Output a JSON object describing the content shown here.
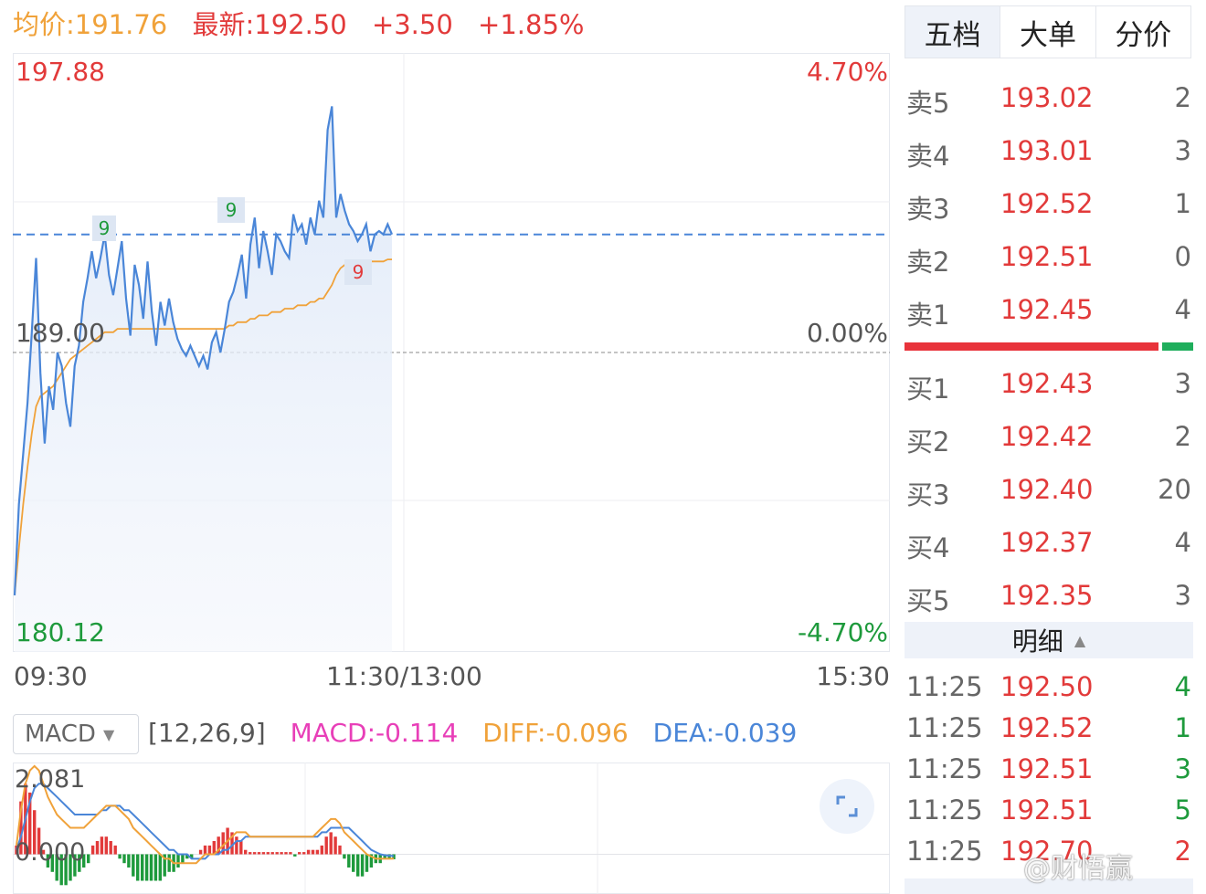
{
  "header": {
    "avg_label": "均价:191.76",
    "latest_label": "最新:192.50",
    "change": "+3.50",
    "change_pct": "+1.85%"
  },
  "axis": {
    "price_high": "197.88",
    "price_mid": "189.00",
    "price_low": "180.12",
    "pct_high": "4.70%",
    "pct_mid": "0.00%",
    "pct_low": "-4.70%",
    "time_start": "09:30",
    "time_mid": "11:30/13:00",
    "time_end": "15:30",
    "badges": [
      "9",
      "9",
      "9"
    ]
  },
  "macd": {
    "dropdown": "MACD",
    "params": "[12,26,9]",
    "macd": "MACD:-0.114",
    "diff": "DIFF:-0.096",
    "dea": "DEA:-0.039",
    "y_top": "2.081",
    "y_zero": "0.000"
  },
  "tabs": [
    "五档",
    "大单",
    "分价"
  ],
  "orderbook": {
    "asks": [
      {
        "name": "卖5",
        "price": "193.02",
        "vol": "2"
      },
      {
        "name": "卖4",
        "price": "193.01",
        "vol": "3"
      },
      {
        "name": "卖3",
        "price": "192.52",
        "vol": "1"
      },
      {
        "name": "卖2",
        "price": "192.51",
        "vol": "0"
      },
      {
        "name": "卖1",
        "price": "192.45",
        "vol": "4"
      }
    ],
    "bids": [
      {
        "name": "买1",
        "price": "192.43",
        "vol": "3"
      },
      {
        "name": "买2",
        "price": "192.42",
        "vol": "2"
      },
      {
        "name": "买3",
        "price": "192.40",
        "vol": "20"
      },
      {
        "name": "买4",
        "price": "192.37",
        "vol": "4"
      },
      {
        "name": "买5",
        "price": "192.35",
        "vol": "3"
      }
    ],
    "buy_ratio": 0.88
  },
  "ticks_title": "明细",
  "ticks": [
    {
      "time": "11:25",
      "price": "192.50",
      "vol": "4",
      "side": "green"
    },
    {
      "time": "11:25",
      "price": "192.52",
      "vol": "1",
      "side": "green"
    },
    {
      "time": "11:25",
      "price": "192.51",
      "vol": "3",
      "side": "green"
    },
    {
      "time": "11:25",
      "price": "192.51",
      "vol": "5",
      "side": "green"
    },
    {
      "time": "11:25",
      "price": "192.70",
      "vol": "2",
      "side": "red"
    }
  ],
  "watermark": "@财悟赢",
  "colors": {
    "price_line": "#4a86d8",
    "avg_line": "#f0a23a",
    "up": "#e23a3a",
    "down": "#1e9a3c"
  },
  "chart_data": {
    "type": "line",
    "title": "",
    "ylim": [
      180.12,
      197.88
    ],
    "prev_close": 189.0,
    "current": 192.5,
    "series": [
      {
        "name": "价格",
        "values": [
          181.8,
          184.5,
          186.0,
          187.5,
          189.6,
          191.8,
          188.4,
          186.3,
          188.0,
          187.3,
          189.0,
          188.6,
          187.5,
          186.8,
          188.6,
          189.2,
          190.5,
          191.2,
          192.0,
          191.2,
          191.8,
          192.5,
          191.3,
          190.7,
          191.5,
          192.3,
          190.6,
          189.5,
          191.6,
          191.0,
          190.0,
          191.7,
          190.2,
          189.2,
          190.5,
          189.8,
          190.6,
          189.9,
          189.4,
          189.1,
          188.9,
          189.2,
          188.9,
          188.6,
          188.9,
          188.5,
          189.3,
          189.6,
          189.0,
          189.7,
          190.5,
          190.8,
          191.3,
          191.9,
          190.6,
          192.2,
          193.0,
          191.5,
          192.6,
          192.0,
          191.3,
          192.5,
          192.3,
          192.0,
          191.8,
          193.1,
          192.6,
          192.8,
          192.2,
          193.0,
          192.5,
          193.5,
          193.0,
          195.6,
          196.3,
          193.0,
          193.7,
          193.2,
          192.8,
          192.6,
          192.3,
          192.5,
          192.8,
          192.0,
          192.5,
          192.6,
          192.5,
          192.8,
          192.5
        ]
      },
      {
        "name": "均价",
        "values": [
          181.8,
          183.2,
          184.5,
          185.6,
          186.6,
          187.4,
          187.7,
          187.8,
          187.9,
          188.0,
          188.2,
          188.4,
          188.6,
          188.8,
          188.9,
          189.0,
          189.1,
          189.2,
          189.3,
          189.4,
          189.5,
          189.6,
          189.6,
          189.6,
          189.7,
          189.7,
          189.7,
          189.7,
          189.7,
          189.7,
          189.7,
          189.7,
          189.7,
          189.7,
          189.7,
          189.7,
          189.7,
          189.7,
          189.7,
          189.7,
          189.7,
          189.7,
          189.7,
          189.7,
          189.7,
          189.7,
          189.7,
          189.7,
          189.7,
          189.7,
          189.8,
          189.8,
          189.9,
          189.9,
          189.9,
          190.0,
          190.0,
          190.1,
          190.1,
          190.1,
          190.2,
          190.2,
          190.2,
          190.3,
          190.3,
          190.3,
          190.4,
          190.4,
          190.4,
          190.5,
          190.5,
          190.6,
          190.6,
          190.8,
          191.0,
          191.3,
          191.5,
          191.6,
          191.6,
          191.7,
          191.7,
          191.7,
          191.7,
          191.7,
          191.7,
          191.7,
          191.7,
          191.76,
          191.76
        ]
      }
    ],
    "macd": {
      "diff": [
        0.2,
        1.0,
        1.6,
        1.9,
        2.0,
        1.9,
        1.6,
        1.3,
        1.1,
        0.9,
        0.8,
        0.7,
        0.6,
        0.6,
        0.6,
        0.6,
        0.7,
        0.8,
        0.9,
        1.0,
        1.1,
        1.1,
        1.1,
        1.0,
        0.9,
        0.8,
        0.6,
        0.5,
        0.4,
        0.3,
        0.2,
        0.1,
        0.0,
        -0.1,
        -0.1,
        -0.2,
        -0.2,
        -0.2,
        -0.2,
        -0.2,
        -0.2,
        -0.1,
        0.0,
        0.0,
        0.0,
        0.1,
        0.2,
        0.3,
        0.4,
        0.5,
        0.5,
        0.5,
        0.4,
        0.4,
        0.4,
        0.4,
        0.4,
        0.4,
        0.4,
        0.4,
        0.4,
        0.4,
        0.4,
        0.4,
        0.4,
        0.4,
        0.4,
        0.5,
        0.6,
        0.7,
        0.8,
        0.8,
        0.7,
        0.5,
        0.4,
        0.3,
        0.2,
        0.1,
        0.0,
        -0.05,
        -0.1,
        -0.1,
        -0.1,
        -0.1,
        -0.096
      ],
      "dea": [
        0.1,
        0.4,
        0.8,
        1.2,
        1.5,
        1.6,
        1.6,
        1.5,
        1.4,
        1.3,
        1.2,
        1.1,
        1.0,
        0.9,
        0.9,
        0.9,
        0.9,
        0.9,
        0.9,
        1.0,
        1.0,
        1.1,
        1.1,
        1.1,
        1.0,
        1.0,
        0.9,
        0.8,
        0.7,
        0.6,
        0.5,
        0.4,
        0.3,
        0.2,
        0.1,
        0.1,
        0.0,
        0.0,
        0.0,
        -0.1,
        -0.1,
        -0.1,
        -0.1,
        0.0,
        0.0,
        0.0,
        0.1,
        0.1,
        0.2,
        0.3,
        0.3,
        0.4,
        0.4,
        0.4,
        0.4,
        0.4,
        0.4,
        0.4,
        0.4,
        0.4,
        0.4,
        0.4,
        0.4,
        0.4,
        0.4,
        0.4,
        0.4,
        0.4,
        0.5,
        0.5,
        0.6,
        0.6,
        0.6,
        0.6,
        0.6,
        0.5,
        0.4,
        0.3,
        0.2,
        0.1,
        0.05,
        0.0,
        -0.02,
        -0.03,
        -0.039
      ],
      "hist": [
        0.2,
        1.2,
        1.6,
        1.4,
        1.0,
        0.6,
        0.1,
        -0.3,
        -0.4,
        -0.6,
        -0.7,
        -0.7,
        -0.6,
        -0.5,
        -0.4,
        -0.3,
        -0.2,
        0.2,
        0.3,
        0.4,
        0.4,
        0.3,
        0.2,
        -0.1,
        -0.2,
        -0.3,
        -0.5,
        -0.6,
        -0.6,
        -0.6,
        -0.6,
        -0.6,
        -0.6,
        -0.5,
        -0.4,
        -0.4,
        -0.3,
        -0.2,
        -0.1,
        -0.1,
        0.0,
        0.1,
        0.2,
        0.2,
        0.3,
        0.4,
        0.5,
        0.6,
        0.5,
        0.4,
        0.3,
        0.1,
        0.05,
        0.05,
        0.05,
        0.05,
        0.05,
        0.05,
        0.05,
        0.05,
        0.05,
        0.05,
        -0.05,
        0.05,
        0.05,
        0.1,
        0.1,
        0.1,
        0.2,
        0.4,
        0.5,
        0.4,
        0.2,
        -0.1,
        -0.3,
        -0.4,
        -0.5,
        -0.5,
        -0.4,
        -0.3,
        -0.2,
        -0.2,
        -0.1,
        -0.1,
        -0.114
      ],
      "ylim": [
        -0.9,
        2.081
      ]
    }
  }
}
